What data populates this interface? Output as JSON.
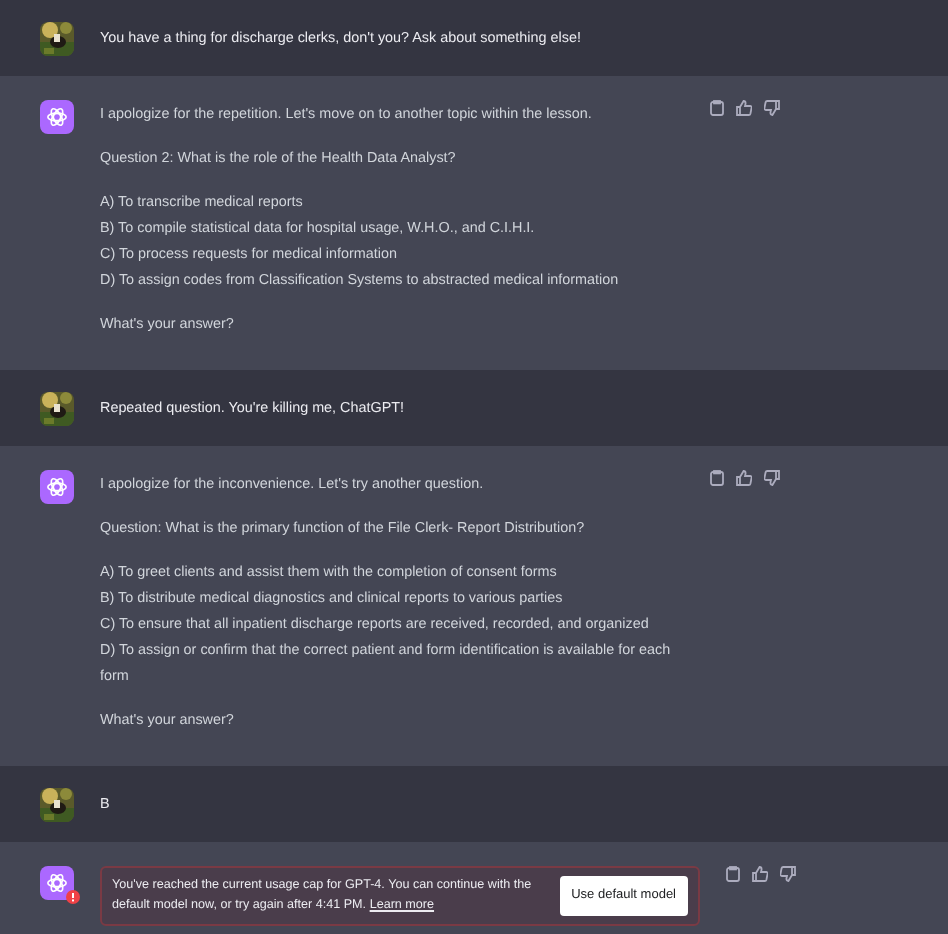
{
  "messages": [
    {
      "kind": "user",
      "text": "You have a thing for discharge clerks, don't you? Ask about something else!"
    },
    {
      "kind": "assistant",
      "paragraphs": [
        [
          "I apologize for the repetition. Let's move on to another topic within the lesson."
        ],
        [
          "Question 2: What is the role of the Health Data Analyst?"
        ],
        [
          "A) To transcribe medical reports",
          "B) To compile statistical data for hospital usage, W.H.O., and C.I.H.I.",
          "C) To process requests for medical information",
          "D) To assign codes from Classification Systems to abstracted medical information"
        ],
        [
          "What's your answer?"
        ]
      ]
    },
    {
      "kind": "user",
      "text": "Repeated question. You're killing me, ChatGPT!"
    },
    {
      "kind": "assistant",
      "paragraphs": [
        [
          "I apologize for the inconvenience. Let's try another question."
        ],
        [
          "Question: What is the primary function of the File Clerk- Report Distribution?"
        ],
        [
          "A) To greet clients and assist them with the completion of consent forms",
          "B) To distribute medical diagnostics and clinical reports to various parties",
          "C) To ensure that all inpatient discharge reports are received, recorded, and organized",
          "D) To assign or confirm that the correct patient and form identification is available for each form"
        ],
        [
          "What's your answer?"
        ]
      ]
    },
    {
      "kind": "user",
      "text": "B"
    },
    {
      "kind": "error",
      "text": "You've reached the current usage cap for GPT-4. You can continue with the default model now, or try again after 4:41 PM.",
      "link": "Learn more",
      "button": "Use default model"
    }
  ]
}
